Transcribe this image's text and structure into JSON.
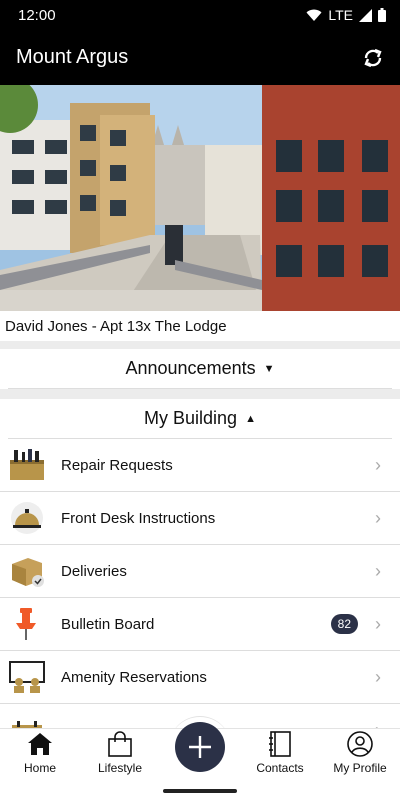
{
  "status_bar": {
    "time": "12:00",
    "network": "LTE"
  },
  "app_bar": {
    "title": "Mount Argus"
  },
  "resident": {
    "text": "David Jones - Apt 13x The Lodge"
  },
  "sections": {
    "announcements": {
      "label": "Announcements"
    },
    "my_building": {
      "label": "My Building"
    }
  },
  "building_items": [
    {
      "label": "Repair Requests",
      "icon": "toolbox-icon"
    },
    {
      "label": "Front Desk Instructions",
      "icon": "service-bell-icon"
    },
    {
      "label": "Deliveries",
      "icon": "package-icon"
    },
    {
      "label": "Bulletin Board",
      "icon": "pushpin-icon",
      "badge": "82"
    },
    {
      "label": "Amenity Reservations",
      "icon": "presentation-icon"
    },
    {
      "label": "",
      "icon": "calendar-icon"
    }
  ],
  "bottom_nav": {
    "home": "Home",
    "lifestyle": "Lifestyle",
    "contacts": "Contacts",
    "profile": "My Profile"
  },
  "colors": {
    "bar": "#000000",
    "accent": "#2b3147",
    "icon_gold": "#b8954a"
  }
}
